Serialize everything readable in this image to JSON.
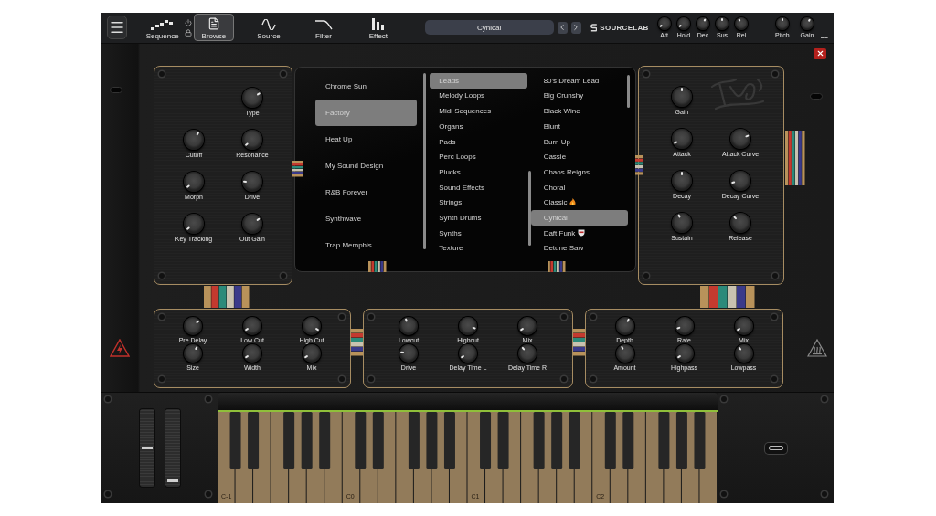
{
  "toolbar": {
    "tabs": [
      {
        "label": "Sequence",
        "selected": false
      },
      {
        "label": "Browse",
        "selected": true
      },
      {
        "label": "Source",
        "selected": false
      },
      {
        "label": "Filter",
        "selected": false
      },
      {
        "label": "Effect",
        "selected": false
      }
    ],
    "preset": "Cynical",
    "brand": "SOURCELAB",
    "knobs": [
      {
        "label": "Att"
      },
      {
        "label": "Hold"
      },
      {
        "label": "Dec"
      },
      {
        "label": "Sus"
      },
      {
        "label": "Rel"
      },
      {
        "label": "Pitch"
      },
      {
        "label": "Gain"
      }
    ]
  },
  "filter": {
    "rows": [
      {
        "knobs": [
          {
            "label": "Type"
          }
        ]
      },
      {
        "knobs": [
          {
            "label": "Cutoff"
          },
          {
            "label": "Resonance"
          }
        ]
      },
      {
        "knobs": [
          {
            "label": "Morph"
          },
          {
            "label": "Drive"
          }
        ]
      },
      {
        "knobs": [
          {
            "label": "Key Tracking"
          },
          {
            "label": "Out Gain"
          }
        ]
      }
    ]
  },
  "browser": {
    "banks": [
      {
        "label": "Chrome Sun",
        "selected": false
      },
      {
        "label": "Factory",
        "selected": true
      },
      {
        "label": "Heat Up",
        "selected": false
      },
      {
        "label": "My Sound Design",
        "selected": false
      },
      {
        "label": "R&B Forever",
        "selected": false
      },
      {
        "label": "Synthwave",
        "selected": false
      },
      {
        "label": "Trap Memphis",
        "selected": false
      }
    ],
    "categories": [
      {
        "label": "Leads",
        "selected": true
      },
      {
        "label": "Melody Loops",
        "selected": false
      },
      {
        "label": "Midi Sequences",
        "selected": false
      },
      {
        "label": "Organs",
        "selected": false
      },
      {
        "label": "Pads",
        "selected": false
      },
      {
        "label": "Perc Loops",
        "selected": false
      },
      {
        "label": "Plucks",
        "selected": false
      },
      {
        "label": "Sound Effects",
        "selected": false
      },
      {
        "label": "Strings",
        "selected": false
      },
      {
        "label": "Synth Drums",
        "selected": false
      },
      {
        "label": "Synths",
        "selected": false
      },
      {
        "label": "Texture",
        "selected": false
      }
    ],
    "presets": [
      {
        "label": "80's Dream Lead",
        "selected": false,
        "kind": "plain"
      },
      {
        "label": "Big Crunshy",
        "selected": false,
        "kind": "plain"
      },
      {
        "label": "Black Wine",
        "selected": false,
        "kind": "plain"
      },
      {
        "label": "Blunt",
        "selected": false,
        "kind": "plain"
      },
      {
        "label": "Burn Up",
        "selected": false,
        "kind": "plain"
      },
      {
        "label": "Cassie",
        "selected": false,
        "kind": "plain"
      },
      {
        "label": "Chaos Reigns",
        "selected": false,
        "kind": "plain"
      },
      {
        "label": "Choral",
        "selected": false,
        "kind": "plain"
      },
      {
        "label": "Classic",
        "selected": false,
        "kind": "flame"
      },
      {
        "label": "Cynical",
        "selected": true,
        "kind": "plain"
      },
      {
        "label": "Daft Funk",
        "selected": false,
        "kind": "helmet"
      },
      {
        "label": "Detune Saw",
        "selected": false,
        "kind": "plain"
      }
    ]
  },
  "envelope": {
    "rows": [
      {
        "knobs": [
          {
            "label": "Gain"
          }
        ]
      },
      {
        "knobs": [
          {
            "label": "Attack"
          },
          {
            "label": "Attack Curve"
          }
        ]
      },
      {
        "knobs": [
          {
            "label": "Decay"
          },
          {
            "label": "Decay Curve"
          }
        ]
      },
      {
        "knobs": [
          {
            "label": "Sustain"
          },
          {
            "label": "Release"
          }
        ]
      }
    ]
  },
  "effects": [
    {
      "knobs": [
        {
          "label": "Pre Delay"
        },
        {
          "label": "Low Cut"
        },
        {
          "label": "High Cut"
        },
        {
          "label": "Size"
        },
        {
          "label": "Width"
        },
        {
          "label": "Mix"
        }
      ]
    },
    {
      "knobs": [
        {
          "label": "Lowcut"
        },
        {
          "label": "Highcut"
        },
        {
          "label": "Mix"
        },
        {
          "label": "Drive"
        },
        {
          "label": "Delay Time L"
        },
        {
          "label": "Delay Time R"
        }
      ]
    },
    {
      "knobs": [
        {
          "label": "Depth"
        },
        {
          "label": "Rate"
        },
        {
          "label": "Mix"
        },
        {
          "label": "Amount"
        },
        {
          "label": "Highpass"
        },
        {
          "label": "Lowpass"
        }
      ]
    }
  ],
  "keyboard": {
    "octave_labels": [
      "C-1",
      "C0",
      "C1",
      "C2"
    ]
  }
}
